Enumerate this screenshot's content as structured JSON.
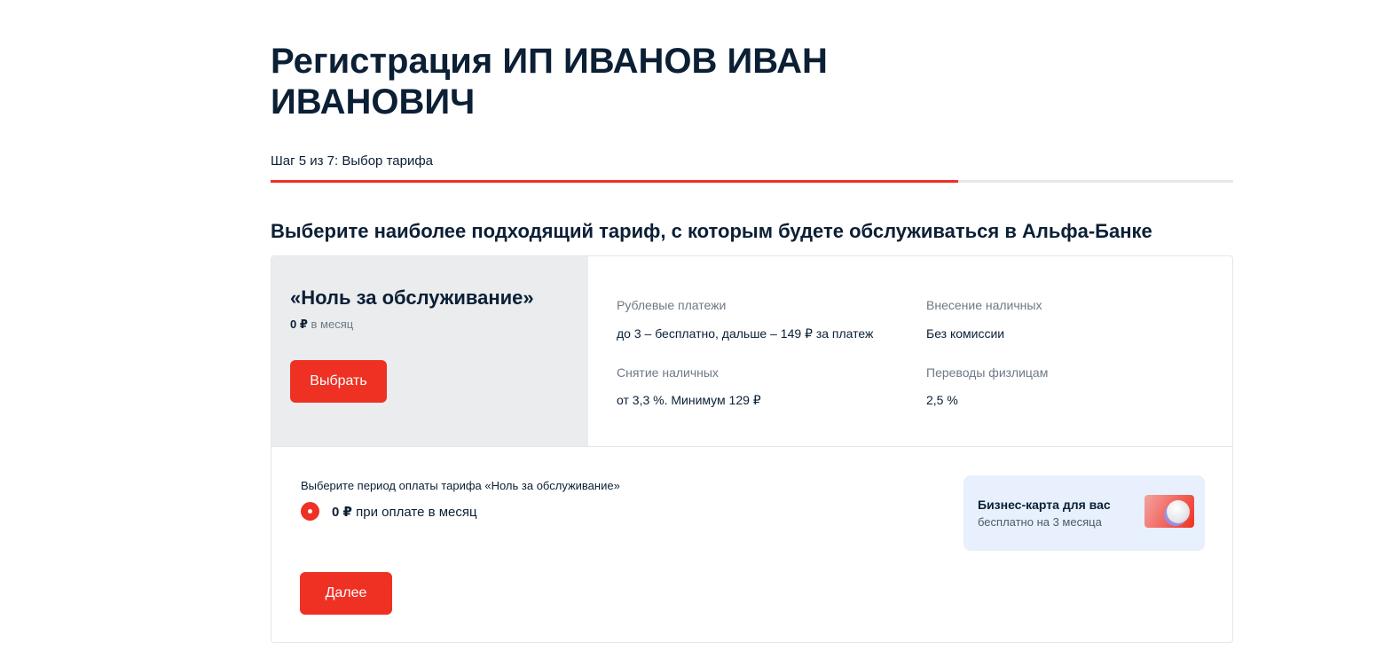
{
  "header": {
    "title": "Регистрация ИП ИВАНОВ ИВАН ИВАНОВИЧ",
    "step": "Шаг 5 из 7: Выбор тарифа",
    "progress_fraction": 0.714
  },
  "section": {
    "heading": "Выберите наиболее подходящий тариф, с которым будете обслуживаться в Альфа-Банке"
  },
  "tariff": {
    "name": "«Ноль за обслуживание»",
    "price_amount": "0 ₽",
    "price_period": " в месяц",
    "choose_label": "Выбрать",
    "features": [
      {
        "label": "Рублевые платежи",
        "value": "до 3 – бесплатно, дальше – 149 ₽ за платеж"
      },
      {
        "label": "Внесение наличных",
        "value": "Без комиссии"
      },
      {
        "label": "Снятие наличных",
        "value": "от 3,3 %. Минимум 129 ₽"
      },
      {
        "label": "Переводы физлицам",
        "value": "2,5 %"
      }
    ]
  },
  "payment_period": {
    "title": "Выберите период оплаты тарифа «Ноль за обслуживание»",
    "option_amount": "0 ₽",
    "option_text": " при оплате в месяц",
    "selected": true
  },
  "promo": {
    "title": "Бизнес-карта для вас",
    "subtitle": "бесплатно на 3 месяца",
    "icon": "business-card-icon"
  },
  "next_label": "Далее",
  "colors": {
    "accent": "#ef3124",
    "text": "#0b1f35",
    "muted": "#6d7986",
    "panel": "#ebecee",
    "promo_bg": "#e7f0fc"
  }
}
